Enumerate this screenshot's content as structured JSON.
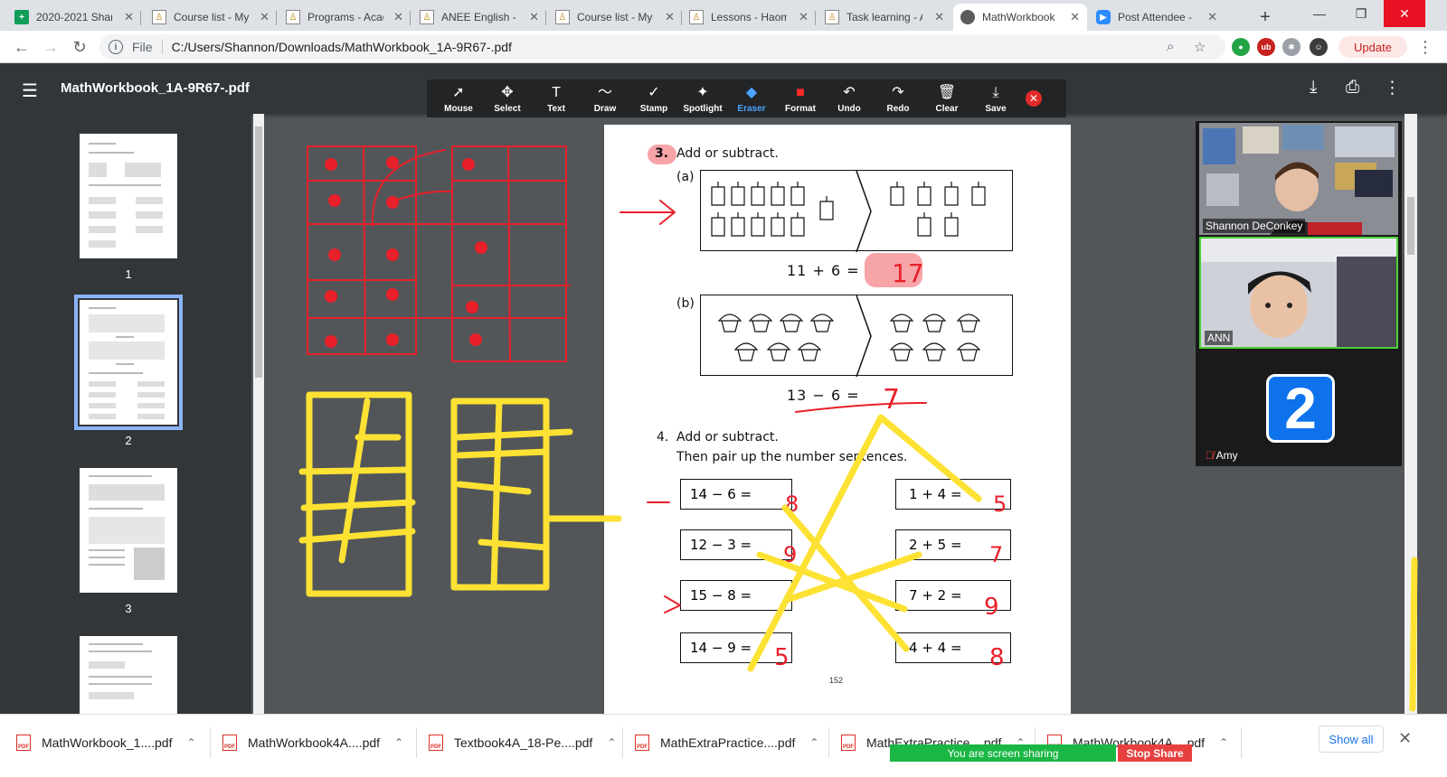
{
  "tabs": [
    {
      "label": "2020-2021 Shan",
      "icon": "sheets-icon"
    },
    {
      "label": "Course list - My",
      "icon": "document-icon"
    },
    {
      "label": "Programs - Acad",
      "icon": "document-icon"
    },
    {
      "label": "ANEE English - C",
      "icon": "document-icon"
    },
    {
      "label": "Course list - My",
      "icon": "document-icon"
    },
    {
      "label": "Lessons - Haom",
      "icon": "document-icon"
    },
    {
      "label": "Task learning - A",
      "icon": "document-icon"
    },
    {
      "label": "MathWorkbook",
      "icon": "mathworkbook-icon",
      "active": true
    },
    {
      "label": "Post Attendee -",
      "icon": "zoom-icon"
    }
  ],
  "address": {
    "scheme": "File",
    "url": "C:/Users/Shannon/Downloads/MathWorkbook_1A-9R67-.pdf"
  },
  "browser": {
    "update_label": "Update"
  },
  "pdf": {
    "title": "MathWorkbook_1A-9R67-.pdf"
  },
  "annotate_tools": [
    {
      "label": "Mouse",
      "glyph": "➚"
    },
    {
      "label": "Select",
      "glyph": "✥"
    },
    {
      "label": "Text",
      "glyph": "T"
    },
    {
      "label": "Draw",
      "glyph": "〜"
    },
    {
      "label": "Stamp",
      "glyph": "✓"
    },
    {
      "label": "Spotlight",
      "glyph": "✦"
    },
    {
      "label": "Eraser",
      "glyph": "◆",
      "active": true
    },
    {
      "label": "Format",
      "glyph": "■"
    },
    {
      "label": "Undo",
      "glyph": "↶"
    },
    {
      "label": "Redo",
      "glyph": "↷"
    },
    {
      "label": "Clear",
      "glyph": "🗑"
    },
    {
      "label": "Save",
      "glyph": "⤓"
    }
  ],
  "thumbnails": [
    {
      "num": "1"
    },
    {
      "num": "2",
      "selected": true
    },
    {
      "num": "3"
    }
  ],
  "document": {
    "q3_num": "3.",
    "q3_title": "Add or subtract.",
    "q3a_label": "(a)",
    "q3a_eq": "11  +  6  =",
    "q3b_label": "(b)",
    "q3b_eq": "13  −  6  =",
    "q4_num": "4.",
    "q4_title": "Add or subtract.",
    "q4_subtitle": "Then pair up the number sentences.",
    "left_sentences": [
      "14  −  6  =",
      "12  −  3  =",
      "15  −  8  =",
      "14  −  9  ="
    ],
    "right_sentences": [
      "1  +  4  =",
      "2  +  5  =",
      "7  +  2  =",
      "4  +  4  ="
    ],
    "page_number": "152"
  },
  "handwriting": {
    "q3a_answer": "17",
    "q3b_answer": "7",
    "left_answers": [
      "8",
      "9",
      "",
      "5"
    ],
    "right_answers": [
      "5",
      "7",
      "9",
      "8"
    ]
  },
  "participants": [
    {
      "name": "Shannon DeConkey"
    },
    {
      "name": "ANN"
    },
    {
      "name": "Amy",
      "badge": "2",
      "muted": true
    }
  ],
  "downloads": [
    {
      "name": "MathWorkbook_1....pdf"
    },
    {
      "name": "MathWorkbook4A....pdf"
    },
    {
      "name": "Textbook4A_18-Pe....pdf"
    },
    {
      "name": "MathExtraPractice....pdf"
    },
    {
      "name": "MathExtraPractice....pdf"
    },
    {
      "name": "MathWorkbook4A....pdf"
    }
  ],
  "download_bar": {
    "show_all": "Show all"
  },
  "share": {
    "banner": "You are screen sharing",
    "stop": "Stop Share"
  },
  "colors": {
    "ink_red": "#e8202a",
    "ink_yellow": "#fde233",
    "highlight": "#f7a4a8",
    "share_green": "#1ab744",
    "stop_red": "#e8403e"
  }
}
